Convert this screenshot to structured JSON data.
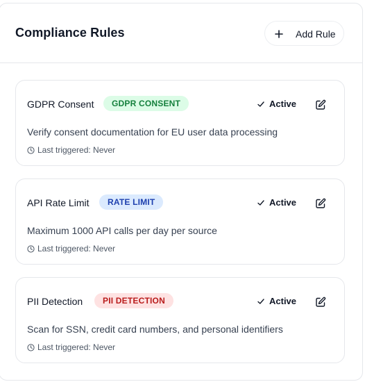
{
  "header": {
    "title": "Compliance Rules",
    "add_button_label": "Add Rule"
  },
  "rules": [
    {
      "name": "GDPR Consent",
      "badge": "GDPR CONSENT",
      "badge_bg": "#dcfce7",
      "badge_color": "#15803d",
      "status": "Active",
      "description": "Verify consent documentation for EU user data processing",
      "last_triggered": "Last triggered: Never"
    },
    {
      "name": "API Rate Limit",
      "badge": "RATE LIMIT",
      "badge_bg": "#dbeafe",
      "badge_color": "#1e40af",
      "status": "Active",
      "description": "Maximum 1000 API calls per day per source",
      "last_triggered": "Last triggered: Never"
    },
    {
      "name": "PII Detection",
      "badge": "PII DETECTION",
      "badge_bg": "#fee2e2",
      "badge_color": "#b91c1c",
      "status": "Active",
      "description": "Scan for SSN, credit card numbers, and personal identifiers",
      "last_triggered": "Last triggered: Never"
    }
  ],
  "icons": {
    "add": "plus-icon",
    "status": "check-icon",
    "edit": "edit-icon",
    "time": "clock-icon"
  }
}
